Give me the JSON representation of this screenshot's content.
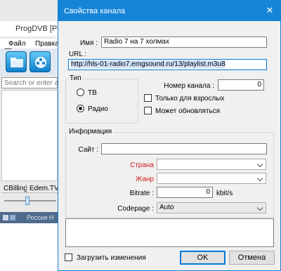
{
  "background_app": {
    "title": "ProgDVB [Po",
    "menu": [
      "Файл",
      "Правка"
    ],
    "search_placeholder": "Search or enter add",
    "tabs": [
      "CBilling",
      "Edem.TV"
    ],
    "status_text": "Россия Н"
  },
  "dialog": {
    "title": "Свойства канала",
    "close_glyph": "✕",
    "name_label": "Имя :",
    "name_value": "Radio 7 на 7 холмах",
    "url_label": "URL :",
    "url_value": "http://hls-01-radio7.emgsound.ru/13/playlist.m3u8",
    "type_legend": "Тип",
    "type_options": [
      "ТВ",
      "Радио"
    ],
    "type_selected": "Радио",
    "channel_number_label": "Номер канала :",
    "channel_number_value": "0",
    "adult_only_label": "Только для взрослых",
    "can_update_label": "Может обновляться",
    "info_legend": "Информация",
    "site_label": "Сайт :",
    "site_value": "",
    "country_label": "Страна",
    "country_value": "",
    "genre_label": "Жанр",
    "genre_value": "",
    "bitrate_label": "Bitrate :",
    "bitrate_value": "0",
    "bitrate_unit": "kbit/s",
    "codepage_label": "Codepage :",
    "codepage_value": "Auto",
    "notes_value": "",
    "load_changes_label": "Загрузить изменения",
    "ok_label": "OK",
    "cancel_label": "Отмена"
  },
  "colors": {
    "titlebar": "#1684d8",
    "required_label": "#d11a1a",
    "status_bar": "#4f6a8c"
  }
}
